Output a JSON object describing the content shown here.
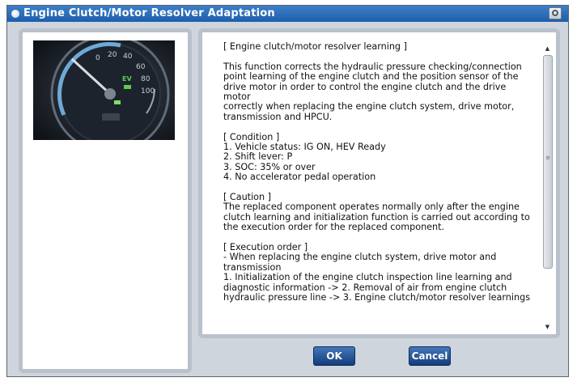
{
  "window": {
    "title": "Engine Clutch/Motor Resolver Adaptation"
  },
  "gauge": {
    "ticks": [
      "0",
      "20",
      "40",
      "60",
      "80",
      "100"
    ],
    "ev_label": "EV",
    "colors": {
      "arc": "#6ea9d8",
      "ev": "#5ccc52",
      "needle": "#d8dde4"
    }
  },
  "content": {
    "lines": [
      "[ Engine clutch/motor resolver learning ]",
      "",
      "This function corrects the hydraulic pressure checking/connection",
      "point learning of the engine clutch and the position sensor of the",
      "drive motor in order to control the engine clutch and the drive motor",
      "correctly when replacing the engine clutch system, drive motor,",
      "transmission and HPCU.",
      "",
      "[ Condition ]",
      "1. Vehicle status: IG ON, HEV Ready",
      "2. Shift lever: P",
      "3. SOC: 35% or over",
      "4. No accelerator pedal operation",
      "",
      "[ Caution ]",
      "The replaced component operates normally only after the engine",
      "clutch learning and initialization function is carried out according to",
      "the execution order for the replaced component.",
      "",
      "[ Execution order ]",
      "- When replacing the engine clutch system, drive motor and",
      "transmission",
      "1. Initialization of the engine clutch inspection line learning and",
      "diagnostic information -> 2. Removal of air from engine clutch",
      "hydraulic pressure line -> 3. Engine clutch/motor resolver learnings"
    ]
  },
  "buttons": {
    "ok": "OK",
    "cancel": "Cancel"
  }
}
